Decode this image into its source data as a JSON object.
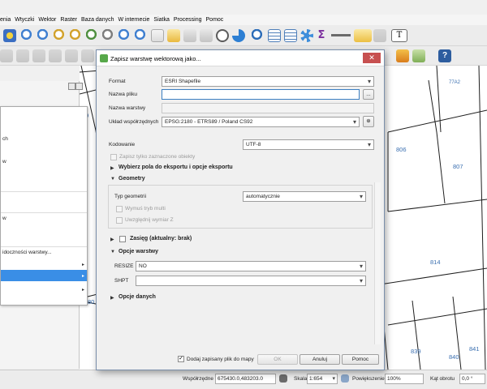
{
  "menu": [
    "enia",
    "Wtyczki",
    "Wektor",
    "Raster",
    "Baza danych",
    "W internecie",
    "Siatka",
    "Processing",
    "Pomoc"
  ],
  "left_panel": {
    "context_items": [
      "ch",
      "w",
      "w",
      "idoczności warstwy..."
    ]
  },
  "map": {
    "parcels": [
      "79",
      "806",
      "807",
      "814",
      "839",
      "840",
      "841",
      "80",
      "77A2"
    ]
  },
  "dialog": {
    "title": "Zapisz warstwę wektorową jako...",
    "close_label": "✕",
    "format_label": "Format",
    "format_value": "ESRI Shapefile",
    "filename_label": "Nazwa pliku",
    "filename_value": "",
    "browse_label": "...",
    "layername_label": "Nazwa warstwy",
    "crs_label": "Układ współrzędnych",
    "crs_value": "EPSG:2180 - ETRS89 / Poland CS92",
    "encoding_label": "Kodowanie",
    "encoding_value": "UTF-8",
    "selected_only_label": "Zapisz tylko zaznaczone obiekty",
    "fields_section": "Wybierz pola do eksportu i opcje eksportu",
    "geometry_section": "Geometry",
    "geometry_type_label": "Typ geometrii",
    "geometry_type_value": "automatycznie",
    "multi_label": "Wymuś tryb multi",
    "z_label": "Uwzględnij wymiar Z",
    "extent_section": "Zasięg (aktualny: brak)",
    "layer_options_section": "Opcje warstwy",
    "resize_label": "RESIZE",
    "resize_value": "NO",
    "shpt_label": "SHPT",
    "shpt_value": "",
    "data_options_section": "Opcje danych",
    "add_to_map_label": "Dodaj zapisany plik do mapy",
    "add_to_map_checked": true,
    "ok_label": "OK",
    "cancel_label": "Anuluj",
    "help_label": "Pomoc"
  },
  "status": {
    "coords_label": "Współrzędne",
    "coords_value": "675430.0,483203.0",
    "scale_label": "Skala",
    "scale_value": "1:654",
    "magnifier_label": "Powiększenie",
    "magnifier_value": "100%",
    "rotation_label": "Kąt obrotu",
    "rotation_value": "0,0 °"
  },
  "colors": {
    "accent": "#3a8ee6",
    "map_line": "#1e1e1e",
    "parcel_label": "#3a6fb0",
    "qgis_green": "#57a84a"
  }
}
